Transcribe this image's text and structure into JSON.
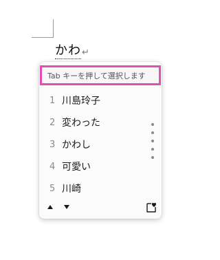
{
  "composition": {
    "text": "かわ",
    "paragraph_mark": "↵"
  },
  "candidate_window": {
    "hint": "Tab キーを押して選択します",
    "candidates": [
      {
        "number": "1",
        "text": "川島玲子"
      },
      {
        "number": "2",
        "text": "変わった"
      },
      {
        "number": "3",
        "text": "かわし"
      },
      {
        "number": "4",
        "text": "可愛い"
      },
      {
        "number": "5",
        "text": "川崎"
      }
    ],
    "footer": {
      "page_up_icon": "triangle-up-icon",
      "page_down_icon": "triangle-down-icon",
      "favorite_icon": "emoji-heart-icon"
    }
  },
  "colors": {
    "hint_highlight": "#e14fb2"
  }
}
